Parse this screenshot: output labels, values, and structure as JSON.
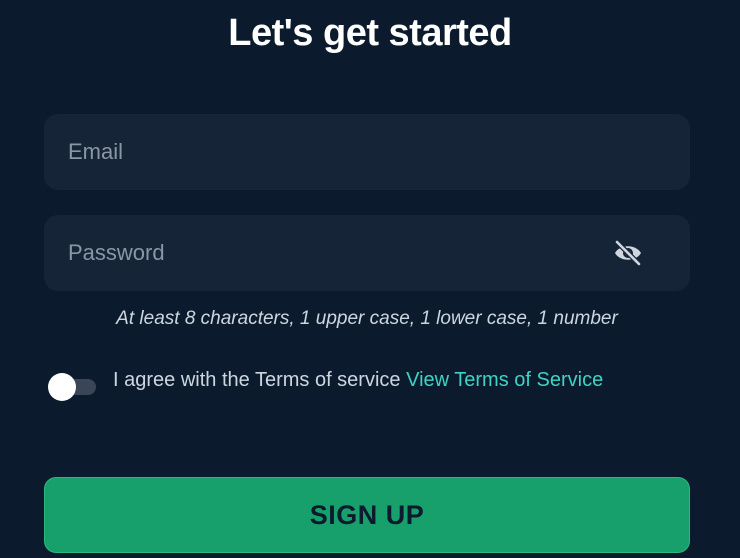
{
  "header": {
    "title": "Let's get started"
  },
  "form": {
    "email": {
      "placeholder": "Email",
      "value": ""
    },
    "password": {
      "placeholder": "Password",
      "value": "",
      "visibility_icon": "eye-off-icon"
    },
    "password_hint": "At least 8 characters, 1 upper case, 1 lower case, 1 number",
    "terms": {
      "text": "I agree with the Terms of service ",
      "link_text": "View Terms of Service",
      "agreed": false
    },
    "submit_label": "SIGN UP"
  },
  "colors": {
    "background": "#0b1b2d",
    "field_background": "#162438",
    "accent_link": "#3ed3c4",
    "button": "#17a06b"
  }
}
